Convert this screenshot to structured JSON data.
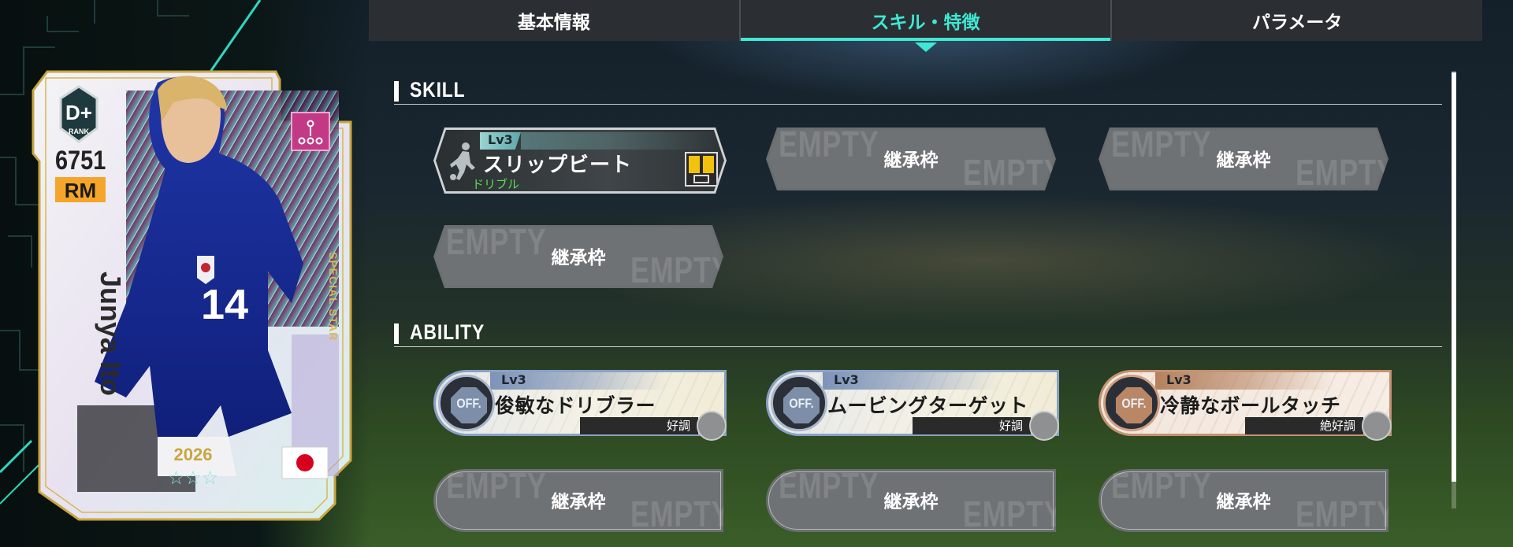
{
  "tabs": [
    {
      "label": "基本情報",
      "active": false
    },
    {
      "label": "スキル・特徴",
      "active": true
    },
    {
      "label": "パラメータ",
      "active": false
    }
  ],
  "player_card": {
    "rank": "D+",
    "rank_label": "RANK",
    "rating": "6751",
    "position": "RM",
    "name": "Junya Ito",
    "edition": "SPECIAL STAR",
    "year": "2026",
    "stars": "☆☆☆",
    "nationality_flag": "japan-flag-icon",
    "shirt_number": "14"
  },
  "skill_section": {
    "title": "SKILL",
    "skills": [
      {
        "level": "Lv3",
        "name": "スリップビート",
        "category": "ドリブル"
      }
    ],
    "empty_label": "継承枠",
    "empty_watermark": "EMPTY"
  },
  "ability_section": {
    "title": "ABILITY",
    "abilities": [
      {
        "level": "Lv3",
        "name": "俊敏なドリブラー",
        "condition": "好調",
        "badge": "OFF."
      },
      {
        "level": "Lv3",
        "name": "ムービングターゲット",
        "condition": "好調",
        "badge": "OFF."
      },
      {
        "level": "Lv3",
        "name": "冷静なボールタッチ",
        "condition": "絶好調",
        "badge": "OFF."
      }
    ],
    "empty_label": "継承枠",
    "empty_watermark": "EMPTY"
  },
  "colors": {
    "accent": "#3fe8d4",
    "category_green": "#58e050",
    "position_badge": "#f5a52a"
  }
}
